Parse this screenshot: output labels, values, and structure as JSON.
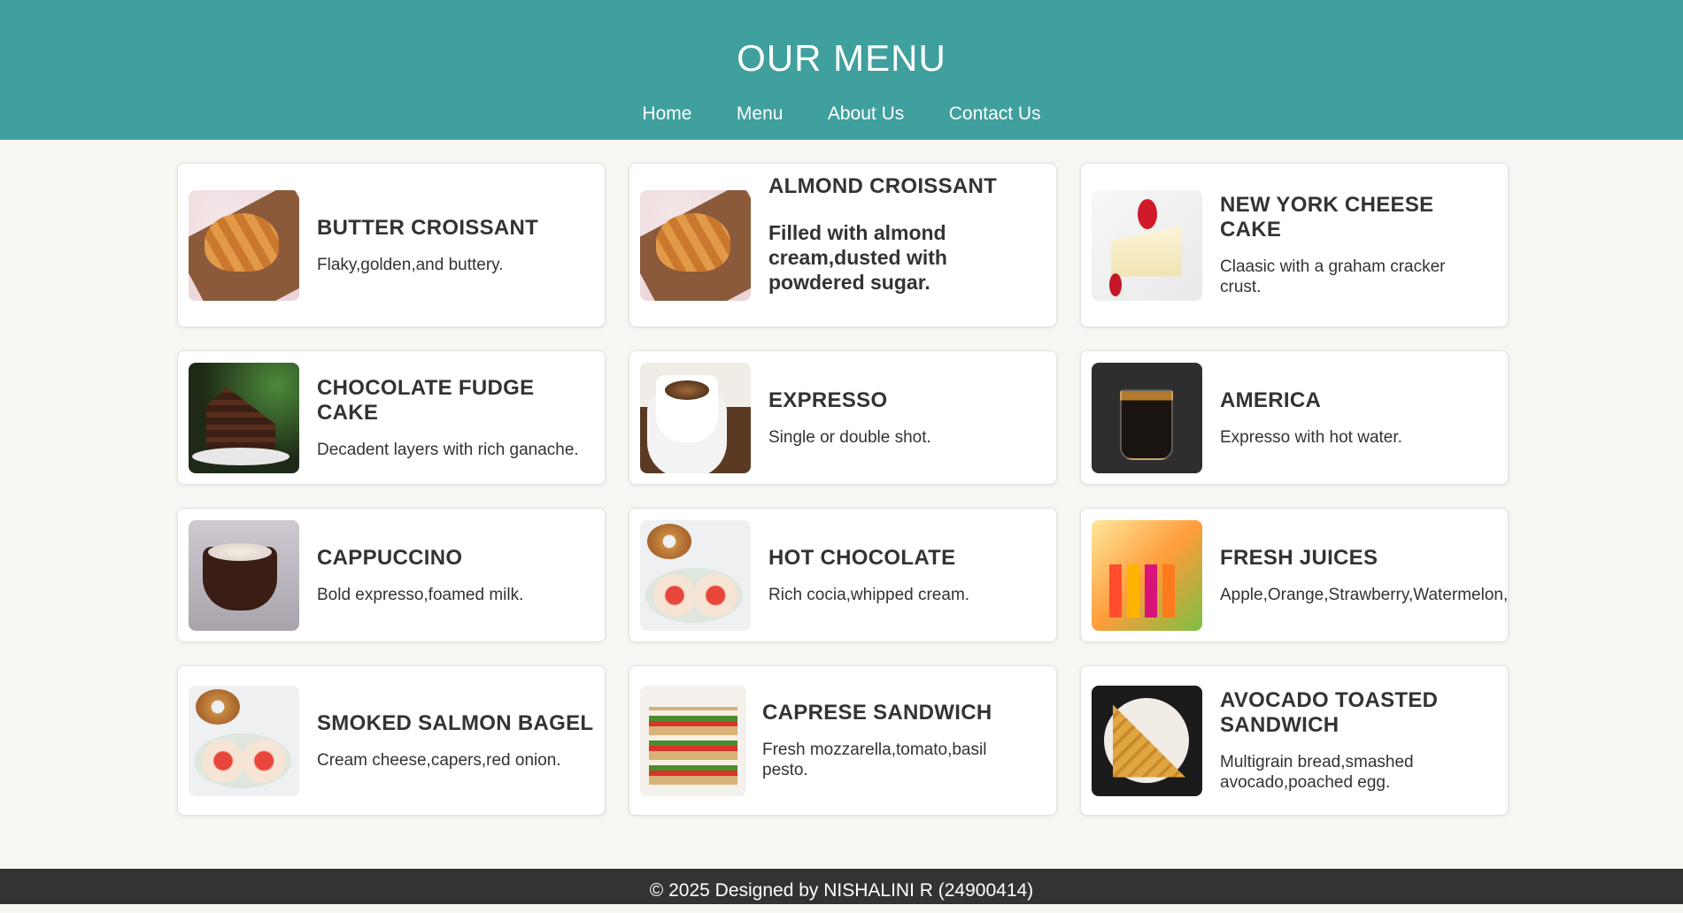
{
  "header": {
    "title": "OUR MENU",
    "nav": [
      "Home",
      "Menu",
      "About Us",
      "Contact Us"
    ]
  },
  "items": [
    {
      "name": "BUTTER CROISSANT",
      "desc": "Flaky,golden,and buttery.",
      "icon": "croissant-image"
    },
    {
      "name": "ALMOND CROISSANT",
      "desc": "Filled with almond cream,dusted with powdered sugar.",
      "icon": "croissant-image"
    },
    {
      "name": "NEW YORK CHEESE CAKE",
      "desc": "Claasic with a graham cracker crust.",
      "icon": "cheesecake-image"
    },
    {
      "name": "CHOCOLATE FUDGE CAKE",
      "desc": "Decadent layers with rich ganache.",
      "icon": "fudge-cake-image"
    },
    {
      "name": "EXPRESSO",
      "desc": "Single or double shot.",
      "icon": "espresso-image"
    },
    {
      "name": "AMERICA",
      "desc": "Expresso with hot water.",
      "icon": "americano-image"
    },
    {
      "name": "CAPPUCCINO",
      "desc": "Bold expresso,foamed milk.",
      "icon": "cappuccino-image"
    },
    {
      "name": "HOT CHOCOLATE",
      "desc": "Rich cocia,whipped cream.",
      "icon": "bagel-image"
    },
    {
      "name": "FRESH JUICES",
      "desc": "Apple,Orange,Strawberry,Watermelon,",
      "icon": "juices-image"
    },
    {
      "name": "SMOKED SALMON BAGEL",
      "desc": "Cream cheese,capers,red onion.",
      "icon": "bagel-image"
    },
    {
      "name": "CAPRESE SANDWICH",
      "desc": "Fresh mozzarella,tomato,basil pesto.",
      "icon": "sandwich-image"
    },
    {
      "name": "AVOCADO TOASTED SANDWICH",
      "desc": "Multigrain bread,smashed avocado,poached egg.",
      "icon": "toast-sandwich-image"
    }
  ],
  "footer": {
    "text": "© 2025 Designed by NISHALINI R (24900414)"
  },
  "colors": {
    "header_bg": "#3fa09e",
    "page_bg": "#f8f6f2",
    "footer_bg": "#333333"
  }
}
